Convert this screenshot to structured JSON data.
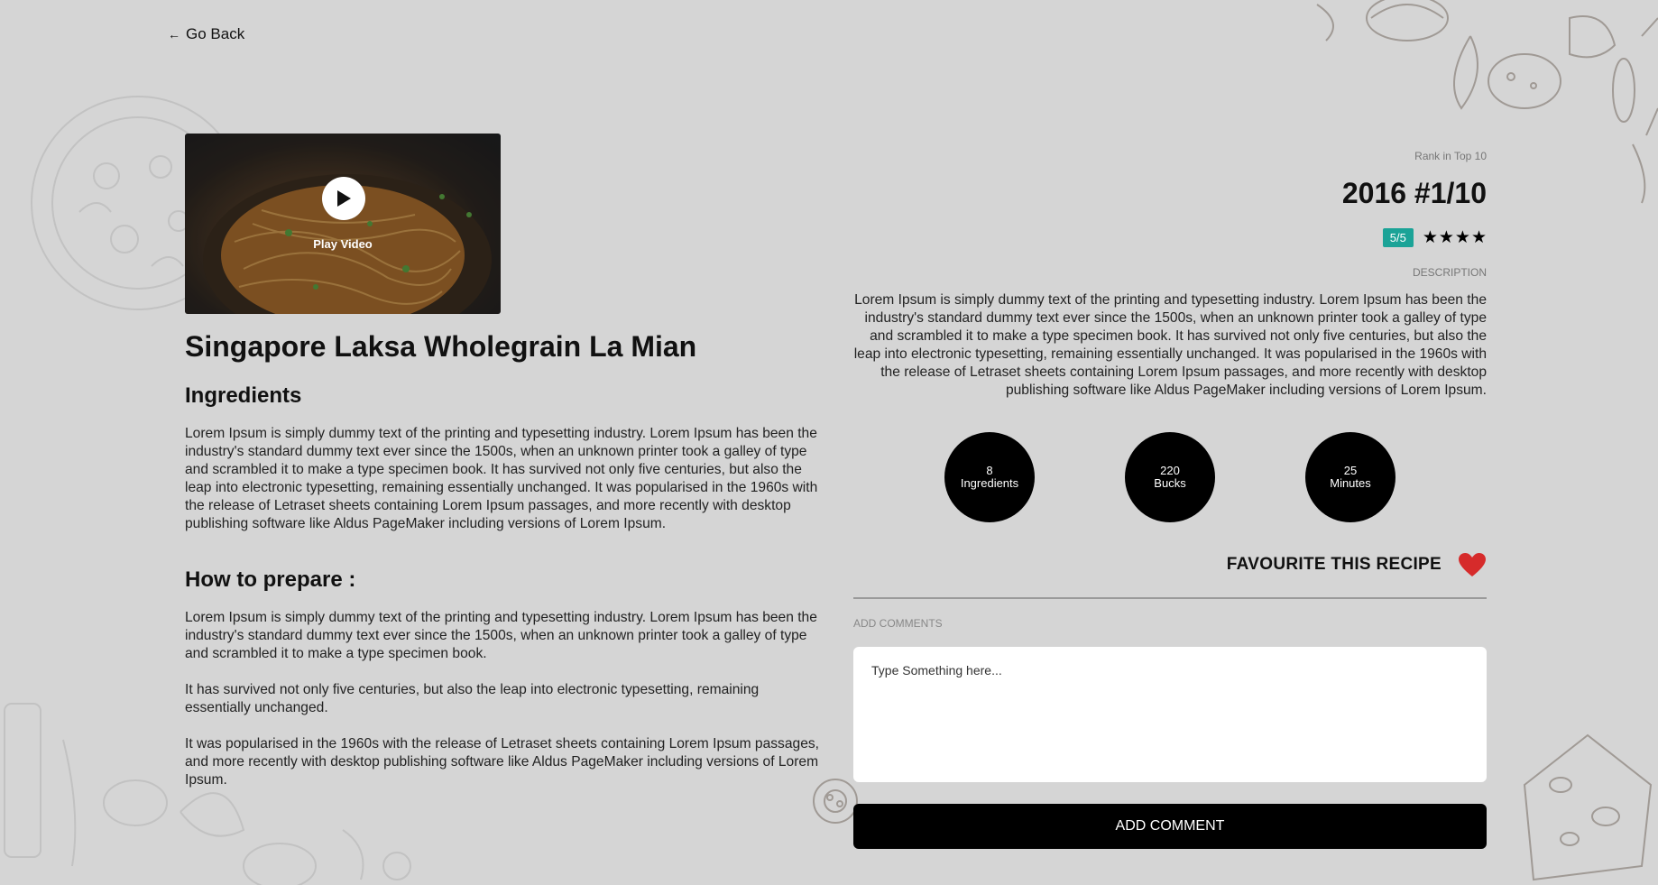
{
  "nav": {
    "back_arrow": "←",
    "back_label": "Go Back"
  },
  "video": {
    "play_label": "Play Video",
    "icon": "play-icon"
  },
  "recipe": {
    "title": "Singapore Laksa Wholegrain La Mian",
    "ingredients_heading": "Ingredients",
    "ingredients_text": "Lorem Ipsum is simply dummy text of the printing and typesetting industry. Lorem Ipsum has been the industry's standard dummy text ever since the 1500s, when an unknown printer took a galley of type and scrambled it to make a type specimen book. It has survived not only five centuries, but also the leap into electronic typesetting, remaining essentially unchanged. It was popularised in the 1960s with the release of Letraset sheets containing Lorem Ipsum passages, and more recently with desktop publishing software like Aldus PageMaker including versions of Lorem Ipsum.",
    "prepare_heading": "How to prepare :",
    "prepare_paragraphs": [
      "Lorem Ipsum is simply dummy text of the printing and typesetting industry. Lorem Ipsum has been the industry's standard dummy text ever since the 1500s, when an unknown printer took a galley of type and scrambled it to make a type specimen book.",
      "It has survived not only five centuries, but also the leap into electronic typesetting, remaining essentially unchanged.",
      "It was popularised in the 1960s with the release of Letraset sheets containing Lorem Ipsum passages, and more recently with desktop publishing software like Aldus PageMaker including versions of Lorem Ipsum."
    ]
  },
  "rank": {
    "label": "Rank in Top 10",
    "value": "2016 #1/10",
    "rating_badge": "5/5",
    "stars_shown": 4,
    "star_glyph": "★"
  },
  "description": {
    "label": "DESCRIPTION",
    "text": "Lorem Ipsum is simply dummy text of the printing and typesetting industry. Lorem Ipsum has been the industry's standard dummy text ever since the 1500s, when an unknown printer took a galley of type and scrambled it to make a type specimen book. It has survived not only five centuries, but also the leap into electronic typesetting, remaining essentially unchanged. It was popularised in the 1960s with the release of Letraset sheets containing Lorem Ipsum passages, and more recently with desktop publishing software like Aldus PageMaker including versions of Lorem Ipsum."
  },
  "stats": [
    {
      "value": "8",
      "label": "Ingredients"
    },
    {
      "value": "220",
      "label": "Bucks"
    },
    {
      "value": "25",
      "label": "Minutes"
    }
  ],
  "favourite": {
    "label": "FAVOURITE THIS RECIPE",
    "icon": "heart-icon",
    "color": "#d62b2b"
  },
  "comments": {
    "label": "ADD COMMENTS",
    "placeholder": "Type Something here...",
    "value": "",
    "button_label": "ADD COMMENT"
  },
  "colors": {
    "background": "#d5d5d5",
    "badge": "#1ba397",
    "accent": "#000000"
  }
}
